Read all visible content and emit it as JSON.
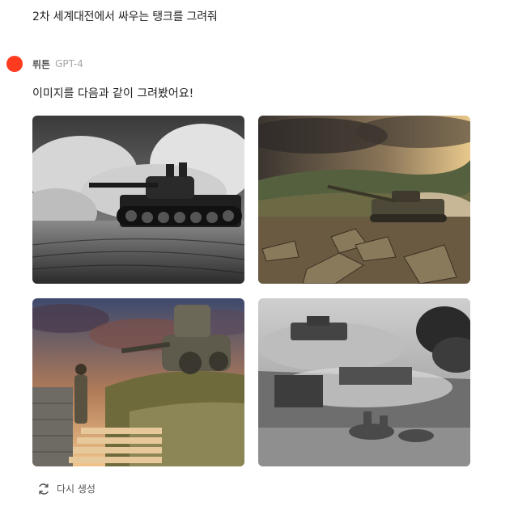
{
  "conversation": {
    "user_prompt": "2차 세계대전에서 싸우는 탱크를 그려줘",
    "assistant": {
      "name": "뤼튼",
      "model": "GPT-4",
      "avatar_color": "#ff3b1f",
      "message": "이미지를 다음과 같이 그려봤어요!"
    }
  },
  "images": [
    {
      "style": "black-and-white photo, tank firing amid smoke"
    },
    {
      "style": "sepia battlefield, tank in dust"
    },
    {
      "style": "illustration, soldier and tank at sunset"
    },
    {
      "style": "grayscale, battlefield with smoke and wreckage"
    }
  ],
  "actions": {
    "regenerate_label": "다시 생성",
    "regenerate_icon": "refresh-icon"
  }
}
